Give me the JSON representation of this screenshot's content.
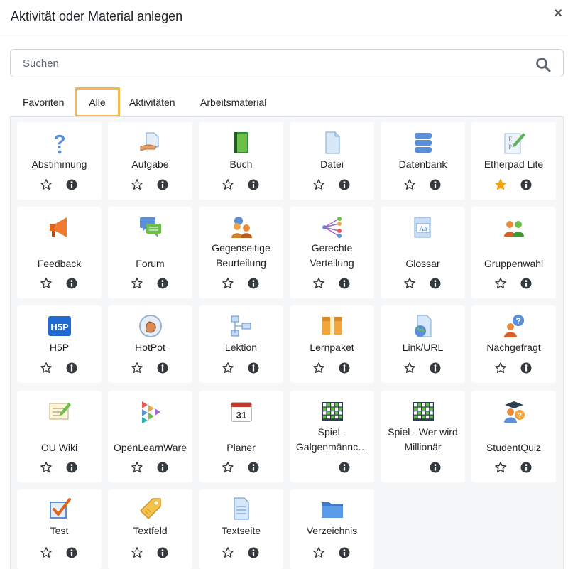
{
  "dialog": {
    "title": "Aktivität oder Material anlegen",
    "close_glyph": "×"
  },
  "search": {
    "placeholder": "Suchen",
    "value": ""
  },
  "tabs": [
    {
      "label": "Favoriten",
      "active": false
    },
    {
      "label": "Alle",
      "active": true
    },
    {
      "label": "Aktivitäten",
      "active": false
    },
    {
      "label": "Arbeitsmaterial",
      "active": false
    }
  ],
  "colors": {
    "accent_tab_border": "#f2ba4d",
    "star_filled": "#f0a30a",
    "icon_dark": "#343a40"
  },
  "modules": [
    {
      "name": [
        "Abstimmung"
      ],
      "icon": "question-mark-icon",
      "starred": false,
      "has_star": true
    },
    {
      "name": [
        "Aufgabe"
      ],
      "icon": "assignment-hand-icon",
      "starred": false,
      "has_star": true
    },
    {
      "name": [
        "Buch"
      ],
      "icon": "book-icon",
      "starred": false,
      "has_star": true
    },
    {
      "name": [
        "Datei"
      ],
      "icon": "file-icon",
      "starred": false,
      "has_star": true
    },
    {
      "name": [
        "Datenbank"
      ],
      "icon": "database-icon",
      "starred": false,
      "has_star": true
    },
    {
      "name": [
        "Etherpad Lite"
      ],
      "icon": "etherpad-icon",
      "starred": true,
      "has_star": true
    },
    {
      "name": [
        "Feedback"
      ],
      "icon": "megaphone-icon",
      "starred": false,
      "has_star": true
    },
    {
      "name": [
        "Forum"
      ],
      "icon": "forum-bubbles-icon",
      "starred": false,
      "has_star": true
    },
    {
      "name": [
        "Gegenseitige",
        "Beurteilung"
      ],
      "icon": "peer-review-icon",
      "starred": false,
      "has_star": true
    },
    {
      "name": [
        "Gerechte",
        "Verteilung"
      ],
      "icon": "distribution-icon",
      "starred": false,
      "has_star": true
    },
    {
      "name": [
        "Glossar"
      ],
      "icon": "glossary-icon",
      "starred": false,
      "has_star": true
    },
    {
      "name": [
        "Gruppenwahl"
      ],
      "icon": "group-choice-icon",
      "starred": false,
      "has_star": true
    },
    {
      "name": [
        "H5P"
      ],
      "icon": "h5p-icon",
      "starred": false,
      "has_star": true
    },
    {
      "name": [
        "HotPot"
      ],
      "icon": "hotpot-icon",
      "starred": false,
      "has_star": true
    },
    {
      "name": [
        "Lektion"
      ],
      "icon": "lesson-icon",
      "starred": false,
      "has_star": true
    },
    {
      "name": [
        "Lernpaket"
      ],
      "icon": "package-icon",
      "starred": false,
      "has_star": true
    },
    {
      "name": [
        "Link/URL"
      ],
      "icon": "url-globe-icon",
      "starred": false,
      "has_star": true
    },
    {
      "name": [
        "Nachgefragt"
      ],
      "icon": "question-person-icon",
      "starred": false,
      "has_star": true
    },
    {
      "name": [
        "OU Wiki"
      ],
      "icon": "wiki-icon",
      "starred": false,
      "has_star": true
    },
    {
      "name": [
        "OpenLearnWare"
      ],
      "icon": "openlearnware-icon",
      "starred": false,
      "has_star": true
    },
    {
      "name": [
        "Planer"
      ],
      "icon": "calendar-icon",
      "starred": false,
      "has_star": true,
      "calendar_day": "31"
    },
    {
      "name": [
        "Spiel -",
        "Galgenmännc…"
      ],
      "icon": "game-board-icon",
      "starred": false,
      "has_star": false
    },
    {
      "name": [
        "Spiel - Wer wird",
        "Millionär"
      ],
      "icon": "game-board-icon",
      "starred": false,
      "has_star": false
    },
    {
      "name": [
        "StudentQuiz"
      ],
      "icon": "student-quiz-icon",
      "starred": false,
      "has_star": true
    },
    {
      "name": [
        "Test"
      ],
      "icon": "quiz-check-icon",
      "starred": false,
      "has_star": true
    },
    {
      "name": [
        "Textfeld"
      ],
      "icon": "label-tag-icon",
      "starred": false,
      "has_star": true
    },
    {
      "name": [
        "Textseite"
      ],
      "icon": "page-icon",
      "starred": false,
      "has_star": true
    },
    {
      "name": [
        "Verzeichnis"
      ],
      "icon": "folder-icon",
      "starred": false,
      "has_star": true
    }
  ]
}
